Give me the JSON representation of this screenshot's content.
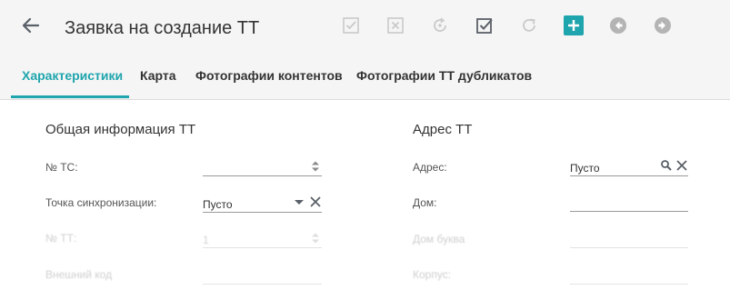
{
  "header": {
    "title": "Заявка на создание ТТ",
    "accent_color": "#1fa5ad",
    "toolbar_icons": [
      "check-square-icon",
      "x-square-icon",
      "refresh-dot-icon",
      "checkbox-checked-icon",
      "redo-icon",
      "plus-icon",
      "arrow-left-circle-icon",
      "arrow-right-circle-icon"
    ]
  },
  "tabs": [
    {
      "label": "Характеристики",
      "active": true
    },
    {
      "label": "Карта",
      "active": false
    },
    {
      "label": "Фотографии контентов",
      "active": false
    },
    {
      "label": "Фотографии ТТ дубликатов",
      "active": false
    }
  ],
  "general": {
    "title": "Общая информация ТТ",
    "tc_label": "№ ТС:",
    "tc_value": "",
    "sync_label": "Точка синхронизации:",
    "sync_value": "Пусто",
    "tt_label": "№ ТТ:",
    "tt_value": "1",
    "extcode_label": "Внешний код"
  },
  "address": {
    "title": "Адрес ТТ",
    "address_label": "Адрес:",
    "address_value": "Пусто",
    "house_label": "Дом:",
    "house_value": "",
    "letter_label": "Дом буква",
    "building_label": "Корпус:"
  }
}
